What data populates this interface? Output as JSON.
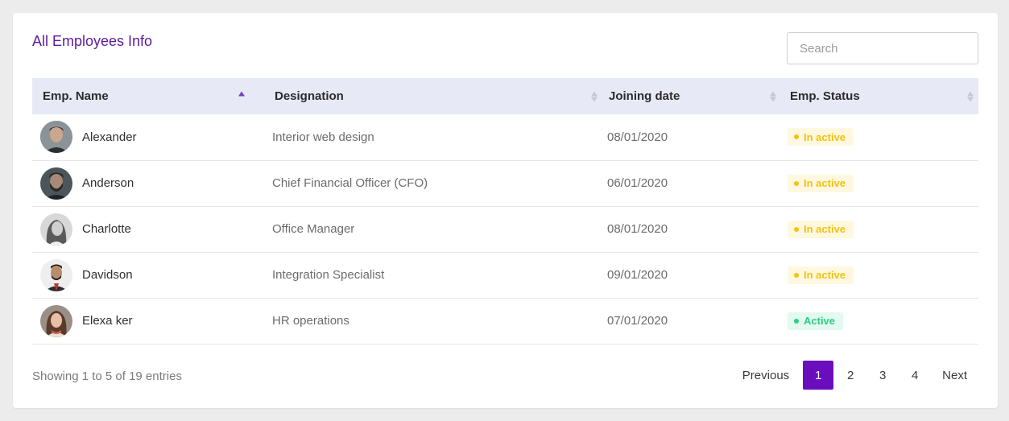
{
  "title": "All Employees Info",
  "search": {
    "placeholder": "Search",
    "value": ""
  },
  "columns": [
    {
      "label": "Emp. Name",
      "sort": "ascending"
    },
    {
      "label": "Designation",
      "sort": "none"
    },
    {
      "label": "Joining date",
      "sort": "none"
    },
    {
      "label": "Emp. Status",
      "sort": "none"
    }
  ],
  "rows": [
    {
      "name": "Alexander",
      "designation": "Interior web design",
      "date": "08/01/2020",
      "status": "In active",
      "status_type": "inactive"
    },
    {
      "name": "Anderson",
      "designation": "Chief Financial Officer (CFO)",
      "date": "06/01/2020",
      "status": "In active",
      "status_type": "inactive"
    },
    {
      "name": "Charlotte",
      "designation": "Office Manager",
      "date": "08/01/2020",
      "status": "In active",
      "status_type": "inactive"
    },
    {
      "name": "Davidson",
      "designation": "Integration Specialist",
      "date": "09/01/2020",
      "status": "In active",
      "status_type": "inactive"
    },
    {
      "name": "Elexa ker",
      "designation": "HR operations",
      "date": "07/01/2020",
      "status": "Active",
      "status_type": "active"
    }
  ],
  "footer": {
    "info": "Showing 1 to 5 of 19 entries"
  },
  "pagination": {
    "previous": "Previous",
    "pages": [
      "1",
      "2",
      "3",
      "4"
    ],
    "current": "1",
    "next": "Next"
  },
  "colors": {
    "accent": "#6a0dbd",
    "title": "#5b1b9c",
    "header_bg": "#e8e9f7",
    "inactive": "#f4c20d",
    "active": "#2ecc85"
  }
}
